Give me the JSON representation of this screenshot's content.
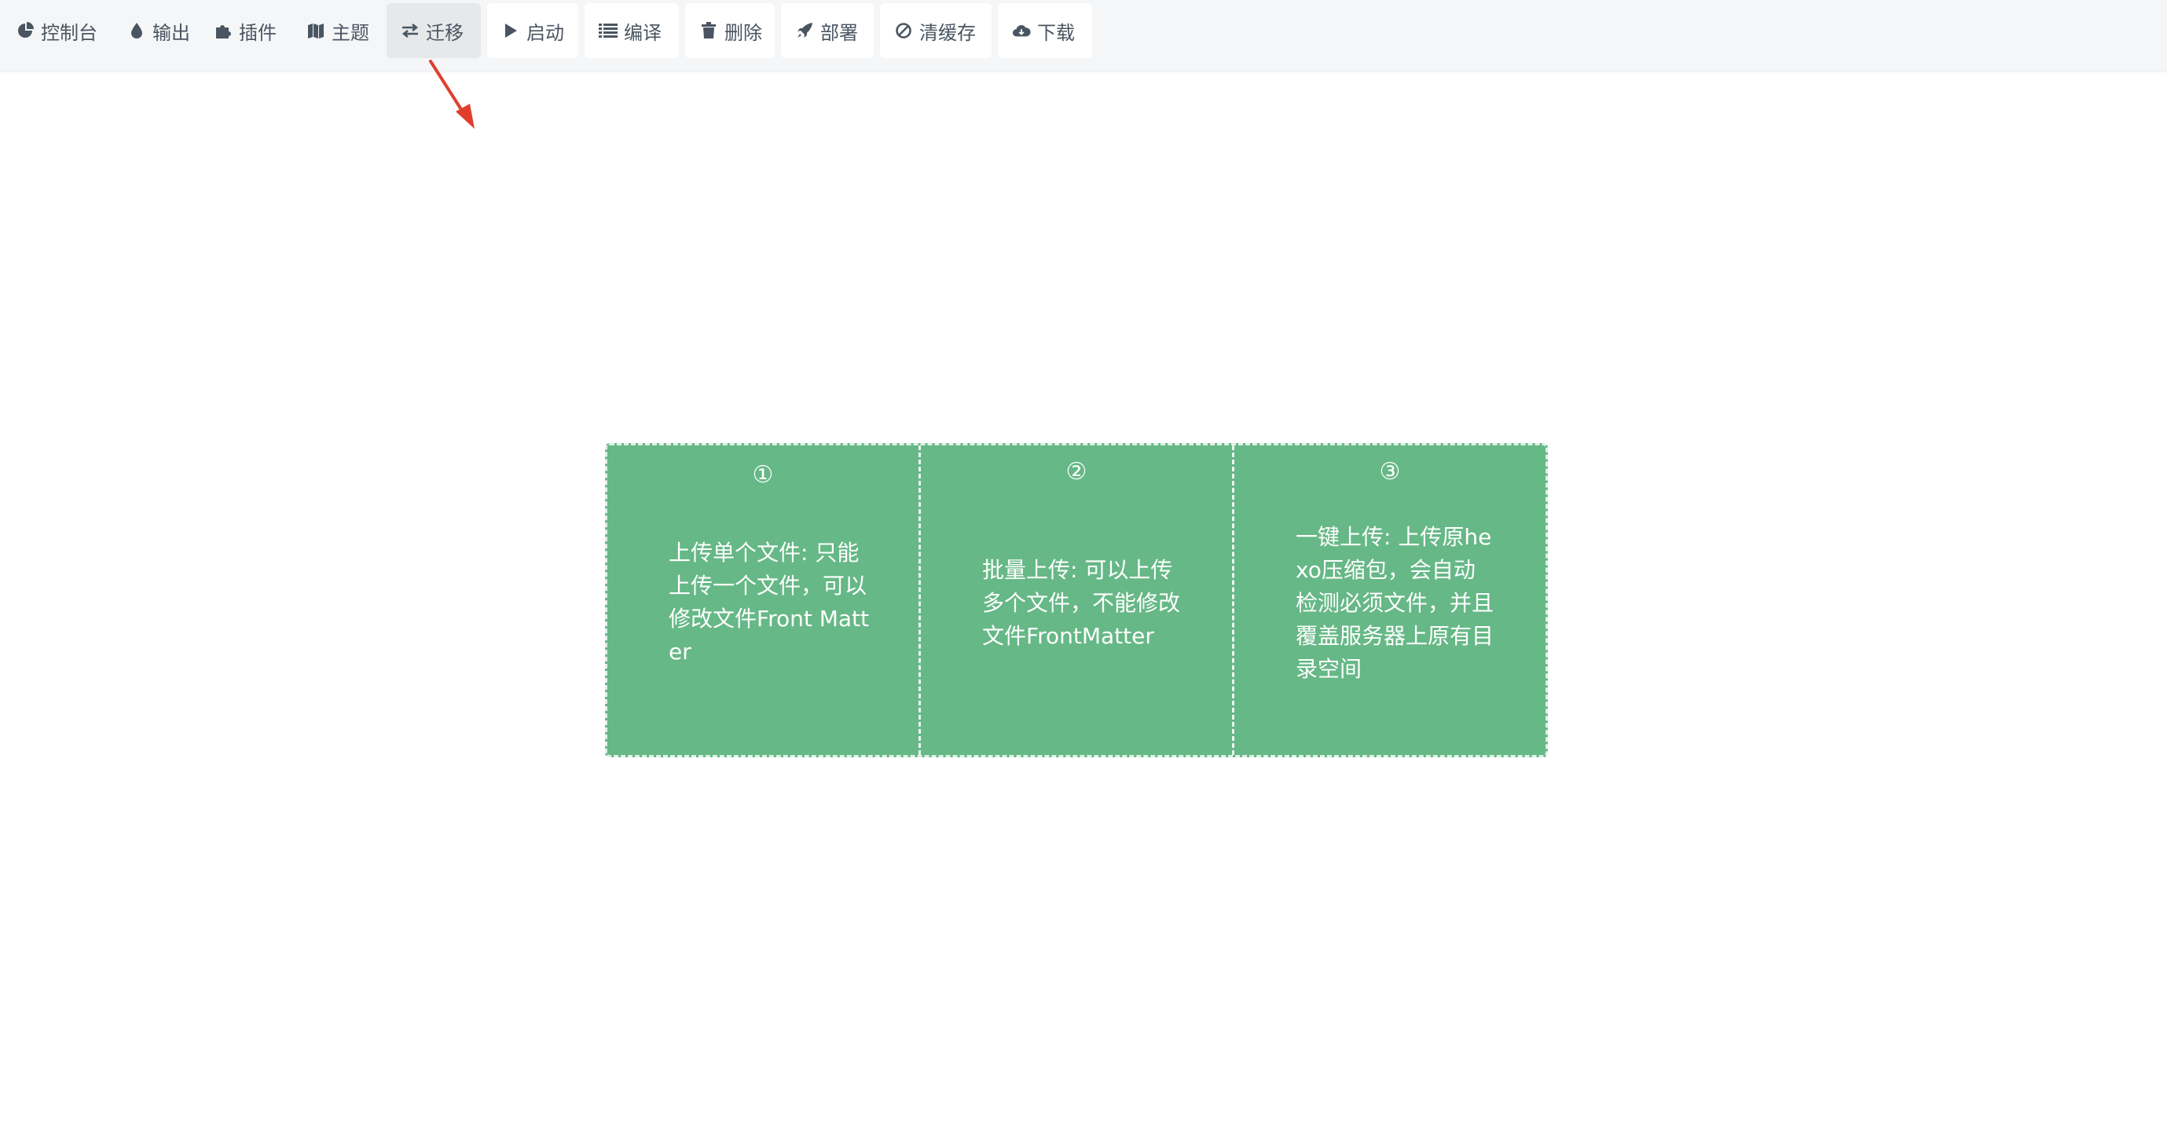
{
  "toolbar": {
    "buttons": [
      {
        "label": "控制台",
        "icon": "dashboard-icon"
      },
      {
        "label": "输出",
        "icon": "droplet-icon"
      },
      {
        "label": "插件",
        "icon": "puzzle-icon"
      },
      {
        "label": "主题",
        "icon": "map-icon"
      },
      {
        "label": "迁移",
        "icon": "exchange-icon"
      },
      {
        "label": "启动",
        "icon": "play-icon"
      },
      {
        "label": "编译",
        "icon": "list-icon"
      },
      {
        "label": "删除",
        "icon": "trash-icon"
      },
      {
        "label": "部署",
        "icon": "rocket-icon"
      },
      {
        "label": "清缓存",
        "icon": "ban-icon"
      },
      {
        "label": "下载",
        "icon": "cloud-download-icon"
      }
    ],
    "active_label": "迁移"
  },
  "annotation": {
    "arrow_color": "#e03e2d"
  },
  "upload_panel": {
    "background_color": "#66b886",
    "cards": [
      {
        "number": "①",
        "text": "上传单个文件: 只能上传一个文件，可以修改文件Front Matter"
      },
      {
        "number": "②",
        "text": "批量上传: 可以上传多个文件，不能修改文件FrontMatter"
      },
      {
        "number": "③",
        "text": "一键上传: 上传原hexo压缩包，会自动检测必须文件，并且覆盖服务器上原有目录空间"
      }
    ]
  }
}
